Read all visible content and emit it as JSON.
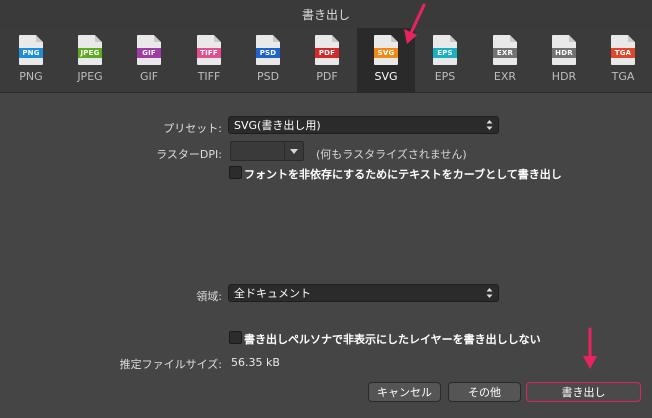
{
  "window": {
    "title": "書き出し"
  },
  "formats": [
    {
      "badge": "PNG",
      "label": "PNG",
      "color": "#1e8fd6"
    },
    {
      "badge": "JPEG",
      "label": "JPEG",
      "color": "#5fa823"
    },
    {
      "badge": "GIF",
      "label": "GIF",
      "color": "#a23aa6"
    },
    {
      "badge": "TIFF",
      "label": "TIFF",
      "color": "#e0508f"
    },
    {
      "badge": "PSD",
      "label": "PSD",
      "color": "#1d63c9"
    },
    {
      "badge": "PDF",
      "label": "PDF",
      "color": "#d22929"
    },
    {
      "badge": "SVG",
      "label": "SVG",
      "color": "#f08a16",
      "selected": true
    },
    {
      "badge": "EPS",
      "label": "EPS",
      "color": "#19b0c4"
    },
    {
      "badge": "EXR",
      "label": "EXR",
      "color": "#727272"
    },
    {
      "badge": "HDR",
      "label": "HDR",
      "color": "#727272"
    },
    {
      "badge": "TGA",
      "label": "TGA",
      "color": "#e0462a"
    }
  ],
  "settings": {
    "preset_label": "プリセット:",
    "preset_value": "SVG(書き出し用)",
    "raster_dpi_label": "ラスターDPI:",
    "raster_dpi_note": "(何もラスタライズされません)",
    "text_to_curves_label": "フォントを非依存にするためにテキストをカーブとして書き出し",
    "area_label": "領域:",
    "area_value": "全ドキュメント",
    "hidden_layers_label": "書き出しペルソナで非表示にしたレイヤーを書き出ししない",
    "file_size_label": "推定ファイルサイズ:",
    "file_size_value": "56.35 kB"
  },
  "buttons": {
    "cancel": "キャンセル",
    "more": "その他",
    "export": "書き出し"
  },
  "colors": {
    "annotation_arrow": "#e8245f",
    "export_outline": "#e0245e"
  }
}
